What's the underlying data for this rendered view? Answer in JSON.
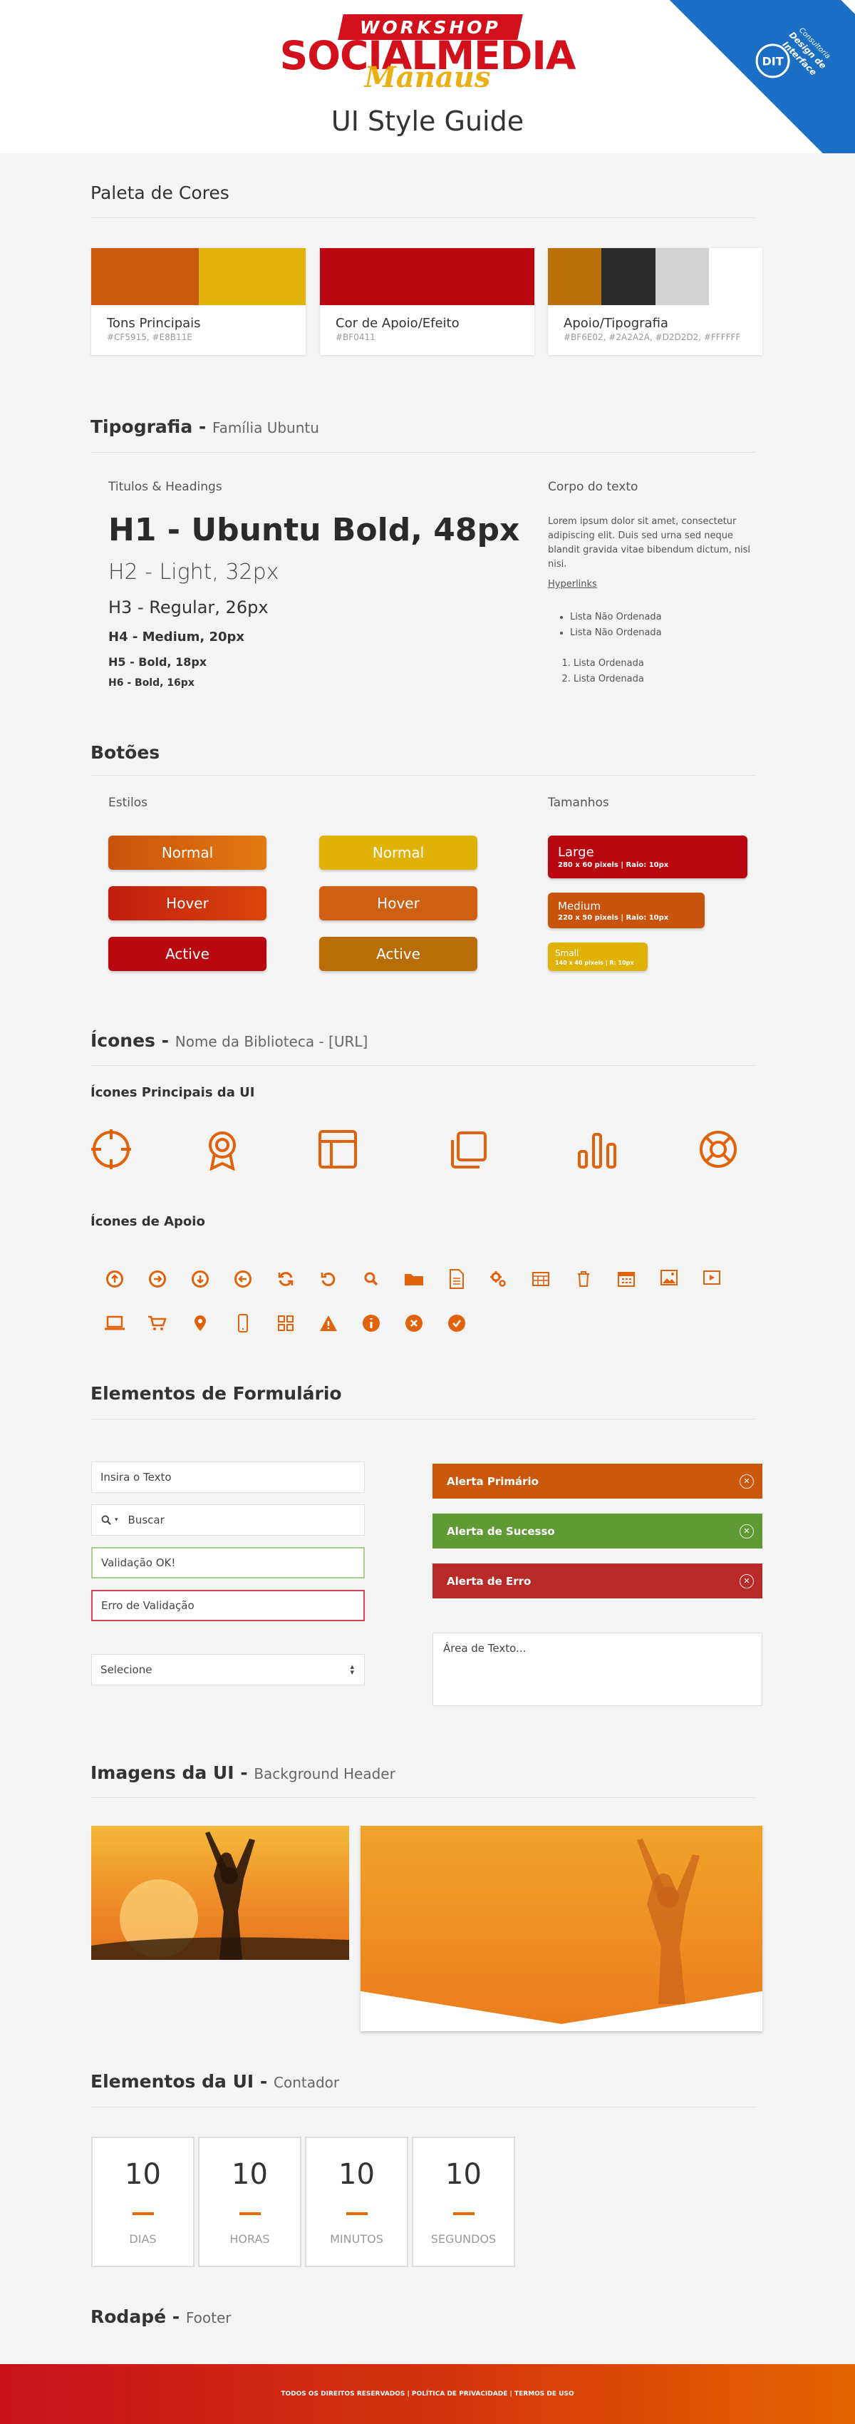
{
  "header": {
    "logo_workshop": "WORKSHOP",
    "logo_socialmedia": "SOCIALMEDIA",
    "logo_manaus": "Manaus",
    "title": "UI Style Guide",
    "ribbon_logo": "DIT",
    "ribbon_line1": "Consultoria",
    "ribbon_line2": "Design de Interface"
  },
  "palette": {
    "title": "Paleta de Cores",
    "cards": [
      {
        "title": "Tons Principais",
        "values": "#CF5915, #E8B11E",
        "colors": [
          "#C95A0E",
          "#E1B20A"
        ]
      },
      {
        "title": "Cor de Apoio/Efeito",
        "values": "#BF0411",
        "colors": [
          "#B90710"
        ]
      },
      {
        "title": "Apoio/Tipografia",
        "values": "#BF6E02, #2A2A2A, #D2D2D2, #FFFFFF",
        "colors": [
          "#B9700A",
          "#2A2A2A",
          "#D2D2D2",
          "#FFFFFF"
        ]
      }
    ]
  },
  "typography": {
    "title": "Tipografia -",
    "subtitle": "Família Ubuntu",
    "headings_label": "Titulos & Headings",
    "h1": "H1 - Ubuntu Bold, 48px",
    "h2": "H2 - Light, 32px",
    "h3": "H3 - Regular, 26px",
    "h4": "H4 - Medium, 20px",
    "h5": "H5 - Bold, 18px",
    "h6": "H6 - Bold, 16px",
    "body_label": "Corpo do texto",
    "body_text": "Lorem ipsum dolor sit amet, consectetur adipiscing elit. Duis sed urna sed neque blandit gravida vitae bibendum dictum, nisl nisi.",
    "hyperlinks": "Hyperlinks",
    "unordered": [
      "Lista Não Ordenada",
      "Lista Não Ordenada"
    ],
    "ordered": [
      "Lista Ordenada",
      "Lista Ordenada"
    ]
  },
  "buttons": {
    "title": "Botões",
    "styles_label": "Estilos",
    "sizes_label": "Tamanhos",
    "primary": [
      "Normal",
      "Hover",
      "Active"
    ],
    "secondary": [
      "Normal",
      "Hover",
      "Active"
    ],
    "sizes": [
      {
        "name": "Large",
        "desc": "280 x 60 pixels  |  Raio: 10px"
      },
      {
        "name": "Medium",
        "desc": "220 x 50 pixels  |  Raio: 10px"
      },
      {
        "name": "Small",
        "desc": "140 x 40 pixels | R: 10px"
      }
    ]
  },
  "icons": {
    "title": "Ícones -",
    "subtitle": "Nome da Biblioteca - [URL]",
    "main_label": "Ícones Principais da UI",
    "support_label": "Ícones de Apoio",
    "main": [
      "crosshair-icon",
      "award-icon",
      "layout-icon",
      "copy-icon",
      "bar-chart-icon",
      "lifebuoy-icon"
    ],
    "support_row1": [
      "arrow-up-circle-icon",
      "arrow-right-circle-icon",
      "arrow-down-circle-icon",
      "arrow-left-circle-icon",
      "refresh-icon",
      "undo-icon",
      "search-icon",
      "folder-icon",
      "document-icon",
      "gears-icon",
      "table-icon",
      "trash-icon",
      "calendar-icon",
      "image-icon",
      "video-icon"
    ],
    "support_row2": [
      "laptop-icon",
      "cart-icon",
      "map-pin-icon",
      "mobile-icon",
      "grid-icon",
      "warning-icon",
      "info-icon",
      "close-circle-icon",
      "check-circle-icon"
    ],
    "accent": "#E0620A"
  },
  "forms": {
    "title": "Elementos de Formulário",
    "input_placeholder": "Insira o Texto",
    "search_placeholder": "Buscar",
    "valid_value": "Validação OK!",
    "error_value": "Erro de Validação",
    "select_value": "Selecione",
    "alert_primary": "Alerta Primário",
    "alert_success": "Alerta de Sucesso",
    "alert_error": "Alerta de Erro",
    "textarea_placeholder": "Área de Texto..."
  },
  "images": {
    "title": "Imagens da UI -",
    "subtitle": "Background Header"
  },
  "counter": {
    "title": "Elementos da UI -",
    "subtitle": "Contador",
    "items": [
      {
        "value": "10",
        "label": "DIAS"
      },
      {
        "value": "10",
        "label": "HORAS"
      },
      {
        "value": "10",
        "label": "MINUTOS"
      },
      {
        "value": "10",
        "label": "SEGUNDOS"
      }
    ]
  },
  "footer": {
    "title": "Rodapé -",
    "subtitle": "Footer",
    "text": "TODOS OS DIREITOS RESERVADOS | POLÍTICA DE PRIVACIDADE | TERMOS DE USO"
  }
}
